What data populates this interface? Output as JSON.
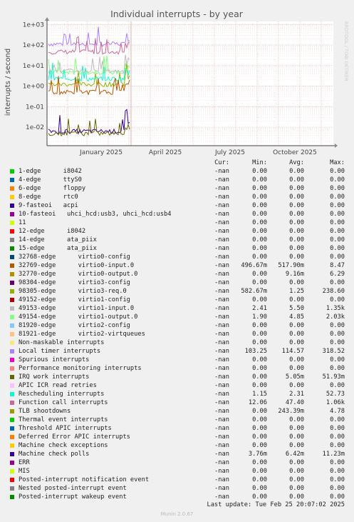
{
  "chart_data": {
    "type": "line",
    "title": "Individual interrupts - by year",
    "ylabel": "interrupts / second",
    "y_scale": "log",
    "y_ticks": [
      "1e+03",
      "1e+02",
      "1e+01",
      "1e+00",
      "1e-01",
      "1e-02"
    ],
    "x_ticks": [
      "January 2025",
      "April 2025",
      "July 2025",
      "October 2025"
    ],
    "grid": true,
    "side_label": "RRDTOOL / TOBI OETIKER",
    "series_approx_levels": [
      {
        "name": "Local timer interrupts",
        "value": 114.57
      },
      {
        "name": "Function call interrupts",
        "value": 47.4
      },
      {
        "name": "virtio1-output.0",
        "value": 4.85
      },
      {
        "name": "virtio3-req.0",
        "value": 1.25
      },
      {
        "name": "Rescheduling interrupts",
        "value": 2.31
      },
      {
        "name": "virtio1-input.0",
        "value": 5.5
      },
      {
        "name": "virtio0-input.0",
        "value": 0.5179
      },
      {
        "name": "Machine check polls",
        "value": 0.00642
      },
      {
        "name": "IRQ work interrupts",
        "value": 0.00505
      }
    ]
  },
  "legend": {
    "headers": {
      "cur": "Cur:",
      "min": "Min:",
      "avg": "Avg:",
      "max": "Max:"
    },
    "rows": [
      {
        "name": "1-edge      i8042",
        "color": "#00cc00",
        "cur": "-nan",
        "min": "0.00",
        "avg": "0.00",
        "max": "0.00"
      },
      {
        "name": "4-edge      ttyS0",
        "color": "#0066b3",
        "cur": "-nan",
        "min": "0.00",
        "avg": "0.00",
        "max": "0.00"
      },
      {
        "name": "6-edge      floppy",
        "color": "#ff8000",
        "cur": "-nan",
        "min": "0.00",
        "avg": "0.00",
        "max": "0.00"
      },
      {
        "name": "8-edge      rtc0",
        "color": "#ffcc00",
        "cur": "-nan",
        "min": "0.00",
        "avg": "0.00",
        "max": "0.00"
      },
      {
        "name": "9-fasteoi   acpi",
        "color": "#330099",
        "cur": "-nan",
        "min": "0.00",
        "avg": "0.00",
        "max": "0.00"
      },
      {
        "name": "10-fasteoi   uhci_hcd:usb3, uhci_hcd:usb4",
        "color": "#990099",
        "cur": "-nan",
        "min": "0.00",
        "avg": "0.00",
        "max": "0.00"
      },
      {
        "name": "11",
        "color": "#ccff00",
        "cur": "-nan",
        "min": "0.00",
        "avg": "0.00",
        "max": "0.00"
      },
      {
        "name": "12-edge      i8042",
        "color": "#ff0000",
        "cur": "-nan",
        "min": "0.00",
        "avg": "0.00",
        "max": "0.00"
      },
      {
        "name": "14-edge      ata_piix",
        "color": "#808080",
        "cur": "-nan",
        "min": "0.00",
        "avg": "0.00",
        "max": "0.00"
      },
      {
        "name": "15-edge      ata_piix",
        "color": "#008f00",
        "cur": "-nan",
        "min": "0.00",
        "avg": "0.00",
        "max": "0.00"
      },
      {
        "name": "32768-edge      virtio0-config",
        "color": "#00487d",
        "cur": "-nan",
        "min": "0.00",
        "avg": "0.00",
        "max": "0.00"
      },
      {
        "name": "32769-edge      virtio0-input.0",
        "color": "#b35a00",
        "cur": "-nan",
        "min": "496.67m",
        "avg": "517.90m",
        "max": "8.47"
      },
      {
        "name": "32770-edge      virtio0-output.0",
        "color": "#b38f00",
        "cur": "-nan",
        "min": "0.00",
        "avg": "9.16m",
        "max": "6.29"
      },
      {
        "name": "98304-edge      virtio3-config",
        "color": "#6b006b",
        "cur": "-nan",
        "min": "0.00",
        "avg": "0.00",
        "max": "0.00"
      },
      {
        "name": "98305-edge      virtio3-req.0",
        "color": "#8fb300",
        "cur": "-nan",
        "min": "582.67m",
        "avg": "1.25",
        "max": "238.60"
      },
      {
        "name": "49152-edge      virtio1-config",
        "color": "#b30000",
        "cur": "-nan",
        "min": "0.00",
        "avg": "0.00",
        "max": "0.00"
      },
      {
        "name": "49153-edge      virtio1-input.0",
        "color": "#bebebe",
        "cur": "-nan",
        "min": "2.41",
        "avg": "5.50",
        "max": "1.35k"
      },
      {
        "name": "49154-edge      virtio1-output.0",
        "color": "#80ff80",
        "cur": "-nan",
        "min": "1.90",
        "avg": "4.85",
        "max": "2.03k"
      },
      {
        "name": "81920-edge      virtio2-config",
        "color": "#80c9ff",
        "cur": "-nan",
        "min": "0.00",
        "avg": "0.00",
        "max": "0.00"
      },
      {
        "name": "81921-edge      virtio2-virtqueues",
        "color": "#ffc080",
        "cur": "-nan",
        "min": "0.00",
        "avg": "0.00",
        "max": "0.00"
      },
      {
        "name": "Non-maskable interrupts",
        "color": "#ffe680",
        "cur": "-nan",
        "min": "0.00",
        "avg": "0.00",
        "max": "0.00"
      },
      {
        "name": "Local timer interrupts",
        "color": "#aa80ff",
        "cur": "-nan",
        "min": "103.25",
        "avg": "114.57",
        "max": "318.52"
      },
      {
        "name": "Spurious interrupts",
        "color": "#ee00cc",
        "cur": "-nan",
        "min": "0.00",
        "avg": "0.00",
        "max": "0.00"
      },
      {
        "name": "Performance monitoring interrupts",
        "color": "#ff8080",
        "cur": "-nan",
        "min": "0.00",
        "avg": "0.00",
        "max": "0.00"
      },
      {
        "name": "IRQ work interrupts",
        "color": "#666600",
        "cur": "-nan",
        "min": "0.00",
        "avg": "5.05m",
        "max": "51.93m"
      },
      {
        "name": "APIC ICR read retries",
        "color": "#ffbfff",
        "cur": "-nan",
        "min": "0.00",
        "avg": "0.00",
        "max": "0.00"
      },
      {
        "name": "Rescheduling interrupts",
        "color": "#00ffcc",
        "cur": "-nan",
        "min": "1.15",
        "avg": "2.31",
        "max": "52.73"
      },
      {
        "name": "Function call interrupts",
        "color": "#cc6699",
        "cur": "-nan",
        "min": "12.06",
        "avg": "47.40",
        "max": "1.06k"
      },
      {
        "name": "TLB shootdowns",
        "color": "#999900",
        "cur": "-nan",
        "min": "0.00",
        "avg": "243.39m",
        "max": "4.78"
      },
      {
        "name": "Thermal event interrupts",
        "color": "#00cc00",
        "cur": "-nan",
        "min": "0.00",
        "avg": "0.00",
        "max": "0.00"
      },
      {
        "name": "Threshold APIC interrupts",
        "color": "#0066b3",
        "cur": "-nan",
        "min": "0.00",
        "avg": "0.00",
        "max": "0.00"
      },
      {
        "name": "Deferred Error APIC interrupts",
        "color": "#ff8000",
        "cur": "-nan",
        "min": "0.00",
        "avg": "0.00",
        "max": "0.00"
      },
      {
        "name": "Machine check exceptions",
        "color": "#ffcc00",
        "cur": "-nan",
        "min": "0.00",
        "avg": "0.00",
        "max": "0.00"
      },
      {
        "name": "Machine check polls",
        "color": "#330099",
        "cur": "-nan",
        "min": "3.76m",
        "avg": "6.42m",
        "max": "11.23m"
      },
      {
        "name": "ERR",
        "color": "#990099",
        "cur": "-nan",
        "min": "0.00",
        "avg": "0.00",
        "max": "0.00"
      },
      {
        "name": "MIS",
        "color": "#ccff00",
        "cur": "-nan",
        "min": "0.00",
        "avg": "0.00",
        "max": "0.00"
      },
      {
        "name": "Posted-interrupt notification event",
        "color": "#ff0000",
        "cur": "-nan",
        "min": "0.00",
        "avg": "0.00",
        "max": "0.00"
      },
      {
        "name": "Nested posted-interrupt event",
        "color": "#808080",
        "cur": "-nan",
        "min": "0.00",
        "avg": "0.00",
        "max": "0.00"
      },
      {
        "name": "Posted-interrupt wakeup event",
        "color": "#008f00",
        "cur": "-nan",
        "min": "0.00",
        "avg": "0.00",
        "max": "0.00"
      }
    ]
  },
  "last_update": "Last update: Tue Feb 25 20:07:02 2025",
  "footer": "Munin 2.0.67"
}
